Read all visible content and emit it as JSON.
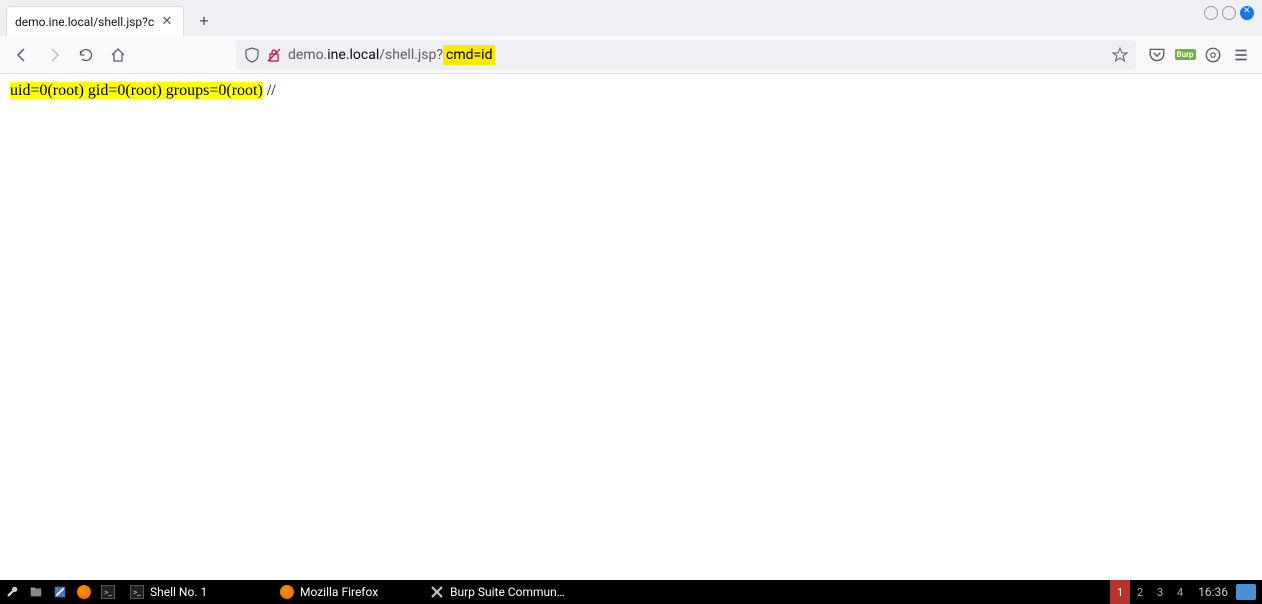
{
  "tab": {
    "title": "demo.ine.local/shell.jsp?c"
  },
  "urlbar": {
    "prefix": "demo.",
    "domain": "ine.local",
    "path": "/shell.jsp?",
    "highlighted": "cmd=id"
  },
  "page": {
    "output_highlighted": "uid=0(root) gid=0(root) groups=0(root)",
    "output_suffix": " //"
  },
  "toolbar_right": {
    "burp_label": "Burp"
  },
  "taskbar": {
    "tasks": [
      {
        "label": "Shell No. 1"
      },
      {
        "label": "Mozilla Firefox"
      },
      {
        "label": "Burp Suite Commun…"
      }
    ],
    "workspaces": [
      "1",
      "2",
      "3",
      "4"
    ],
    "active_workspace": 0,
    "clock": "16:36"
  }
}
